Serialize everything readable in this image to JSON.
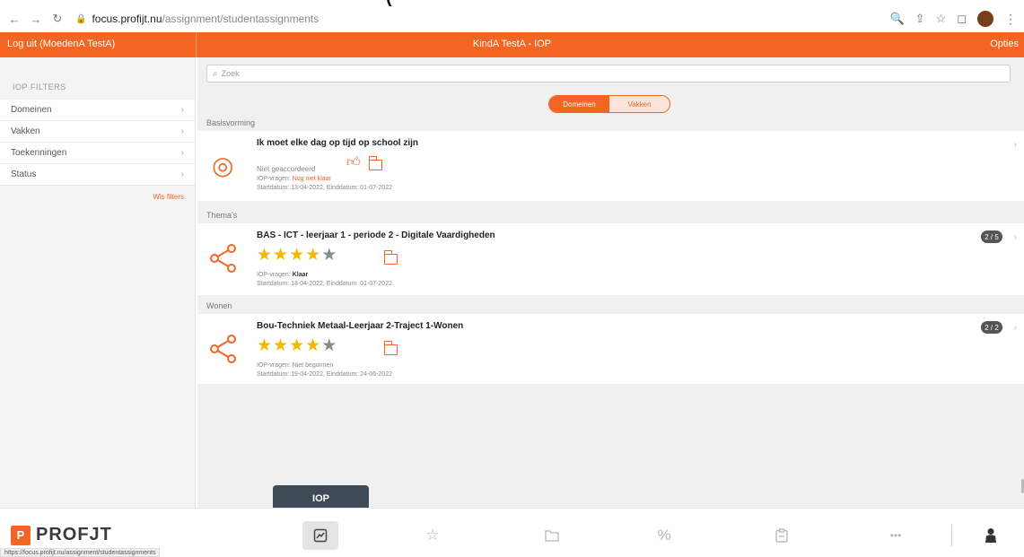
{
  "browser": {
    "url_host": "focus.profijt.nu",
    "url_path": "/assignment/studentassignments",
    "status_url": "https://focus.profijt.nu/assignment/studentassignments",
    "avatar_color": "#7a3d1a"
  },
  "header": {
    "logout_label": "Log uit (MoedenA TestA)",
    "title": "KindA TestA - IOP",
    "options_label": "Opties",
    "accent_color": "#f26522"
  },
  "sidebar": {
    "heading": "IOP FILTERS",
    "items": [
      {
        "label": "Domeinen"
      },
      {
        "label": "Vakken"
      },
      {
        "label": "Toekenningen"
      },
      {
        "label": "Status"
      }
    ],
    "show_more": "Wis filters"
  },
  "main": {
    "search_placeholder": "Zoek",
    "toggle": {
      "active": "Domeinen",
      "inactive": "Vakken"
    },
    "sections": [
      {
        "label": "Basisvorming",
        "title": "Ik moet elke dag op tijd op school zijn",
        "status": "Niet geaccordeerd",
        "iop_label": "IOP-vragen:",
        "iop_value": "Nog niet klaar",
        "dates": "Startdatum: 13-04-2022, Einddatum: 01-07-2022",
        "icon": "target-icon"
      },
      {
        "label": "Thema's",
        "title": "BAS - ICT - leerjaar 1 - periode 2 - Digitale Vaardigheden",
        "rating": 4,
        "rating_max": 5,
        "iop_label": "IOP-vragen:",
        "iop_value": "Klaar",
        "dates": "Startdatum: 13-04-2022, Einddatum: 01-07-2022",
        "badge": "2 / 5",
        "icon": "share-icon"
      },
      {
        "label": "Wonen",
        "title": "Bou-Techniek Metaal-Leerjaar 2-Traject 1-Wonen",
        "rating": 4,
        "rating_max": 5,
        "iop_label": "IOP-vragen:",
        "iop_value": "Niet begonnen",
        "dates": "Startdatum: 19-04-2022, Einddatum: 24-06-2022",
        "badge": "2 / 2",
        "icon": "share-icon"
      }
    ]
  },
  "bottom_nav": {
    "logo_text": "PROFJT",
    "logo_mark": "P",
    "tooltip": "IOP",
    "items": [
      "iop-icon",
      "star-icon",
      "folder-icon",
      "percent-icon",
      "clipboard-icon",
      "more-icon",
      "user-icon"
    ]
  }
}
